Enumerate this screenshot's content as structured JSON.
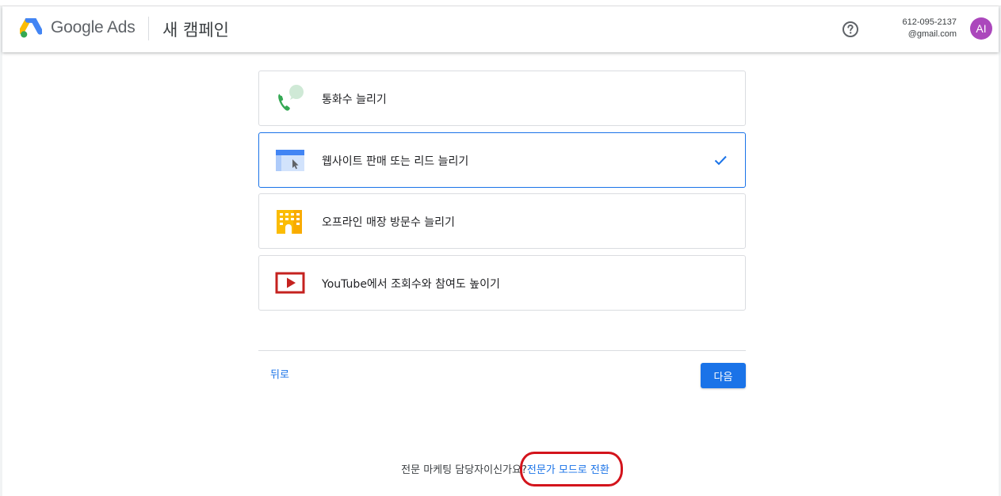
{
  "header": {
    "brand": "Google Ads",
    "page_title": "새 캠페인",
    "account_id": "612-095-2137",
    "account_email": "@gmail.com",
    "avatar_initials": "AI"
  },
  "goals": [
    {
      "label": "통화수 늘리기",
      "icon": "phone-call-icon",
      "selected": false
    },
    {
      "label": "웹사이트 판매 또는 리드 늘리기",
      "icon": "website-icon",
      "selected": true
    },
    {
      "label": "오프라인 매장 방문수 늘리기",
      "icon": "store-building-icon",
      "selected": false
    },
    {
      "label": "YouTube에서 조회수와 참여도 높이기",
      "icon": "youtube-play-icon",
      "selected": false
    }
  ],
  "nav": {
    "back_label": "뒤로",
    "next_label": "다음"
  },
  "footer": {
    "prompt": "전문 마케팅 담당자이신가요?",
    "link": "전문가 모드로 전환"
  },
  "colors": {
    "accent": "#1a73e8",
    "annotation": "#d3141c",
    "avatar": "#ab47bc"
  }
}
